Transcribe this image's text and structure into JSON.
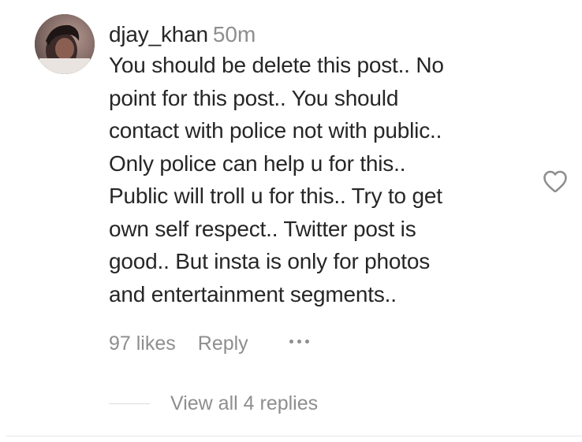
{
  "comment": {
    "username": "djay_khan",
    "time": "50m",
    "text_lines": [
      "You should be delete this post.. No",
      "point for this post.. You should",
      "contact with police not with public..",
      "Only police can help u for this..",
      "Public will troll u for this.. Try to get",
      "own self respect.. Twitter post is",
      "good.. But insta is only for photos",
      "and entertainment segments.."
    ],
    "likes": "97 likes",
    "reply_label": "Reply",
    "more_icon": "more-horizontal-icon",
    "like_icon": "heart-outline-icon",
    "view_replies": "View all 4 replies"
  },
  "colors": {
    "text_primary": "#262626",
    "text_secondary": "#8e8e8e",
    "divider": "#dbdbdb"
  }
}
